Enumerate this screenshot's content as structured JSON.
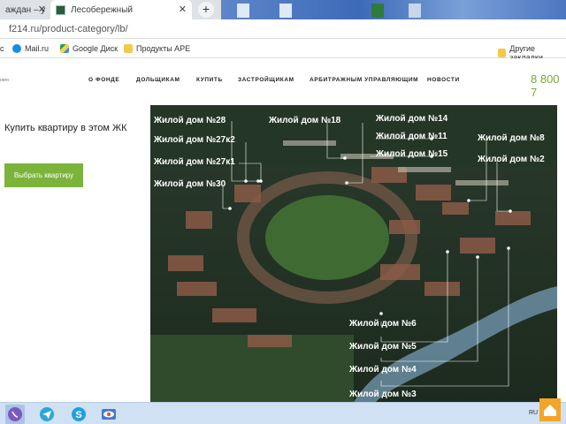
{
  "browser": {
    "tabs": [
      {
        "title": "аждан – у"
      },
      {
        "title": "Лесобережный"
      }
    ],
    "url": "f214.ru/product-category/lb/",
    "bookmarks": {
      "first": "с",
      "mail": "Mail.ru",
      "gdrive": "Google Диск",
      "ape": "Продукты APE",
      "other": "Другие закладки"
    }
  },
  "site": {
    "logo_fragment": "ного",
    "nav": [
      "О ФОНДЕ",
      "ДОЛЬЩИКАМ",
      "КУПИТЬ",
      "ЗАСТРОЙЩИКАМ",
      "АРБИТРАЖНЫМ УПРАВЛЯЮЩИМ",
      "НОВОСТИ"
    ],
    "phone": "8 800 7",
    "buy_title": "Купить квартиру в этом ЖК",
    "choose_button": "Выбрать квартиру"
  },
  "map": {
    "labels": [
      "Жилой дом №28",
      "Жилой дом №27к2",
      "Жилой дом №27к1",
      "Жилой дом №30",
      "Жилой дом №18",
      "Жилой дом №14",
      "Жилой дом №11",
      "Жилой дом №15",
      "Жилой дом №8",
      "Жилой дом №2",
      "Жилой дом №6",
      "Жилой дом №5",
      "Жилой дом №4",
      "Жилой дом №3"
    ]
  },
  "taskbar": {
    "apps": [
      "viber-icon",
      "telegram-icon",
      "skype-icon",
      "eye-app-icon"
    ],
    "tray_text": "RU"
  },
  "colors": {
    "accent_green": "#7bb33b",
    "phone_green": "#7aa83a"
  }
}
